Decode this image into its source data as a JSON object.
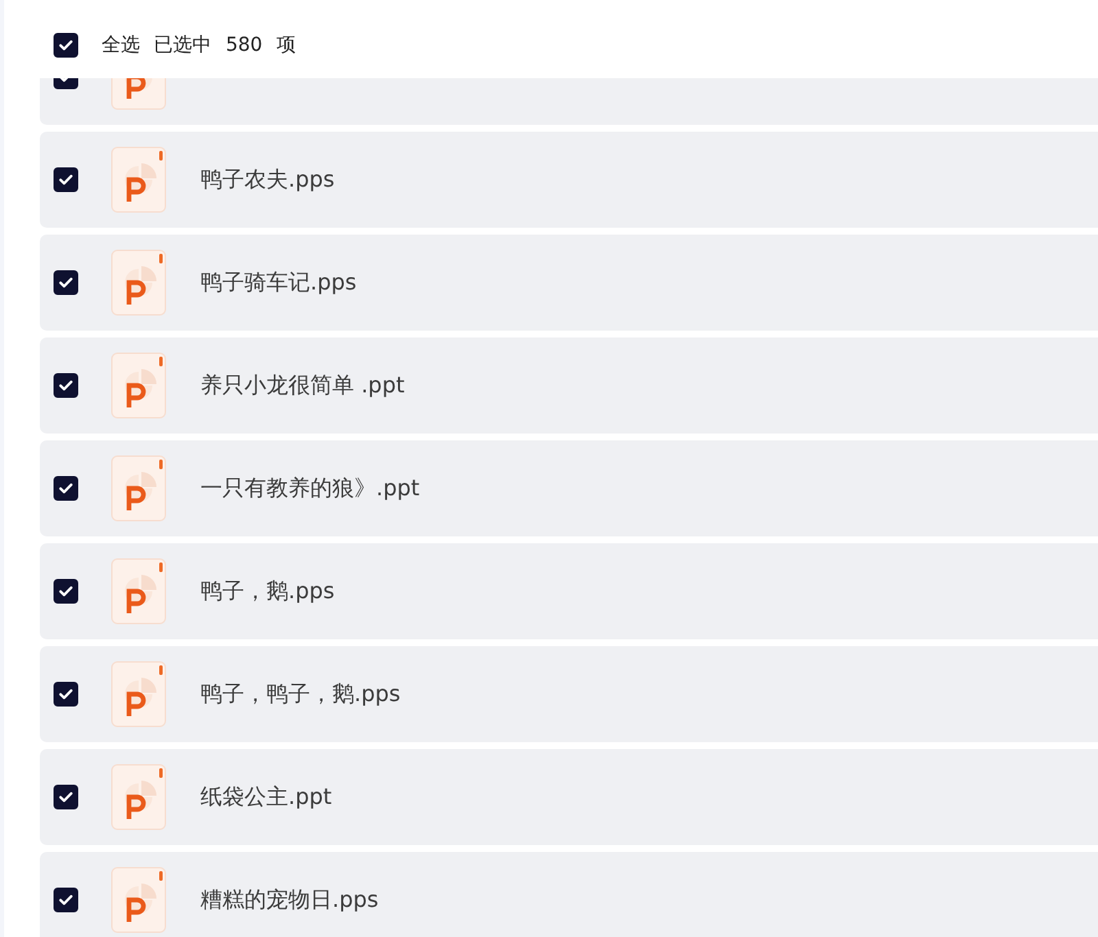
{
  "header": {
    "select_all": {
      "label": "全选",
      "checked": true
    },
    "selection_count": "已选中 580 项"
  },
  "files": [
    {
      "checked": true
    },
    {
      "name": "鸭子农夫.pps",
      "checked": true
    },
    {
      "name": "鸭子骑车记.pps",
      "checked": true
    },
    {
      "name": "养只小龙很简单 .ppt",
      "checked": true
    },
    {
      "name": "一只有教养的狼》.ppt",
      "checked": true
    },
    {
      "name": "鸭子，鹅.pps",
      "checked": true
    },
    {
      "name": "鸭子，鸭子，鹅.pps",
      "checked": true
    },
    {
      "name": "纸袋公主.ppt",
      "checked": true
    },
    {
      "name": "糟糕的宠物日.pps",
      "checked": true
    }
  ]
}
